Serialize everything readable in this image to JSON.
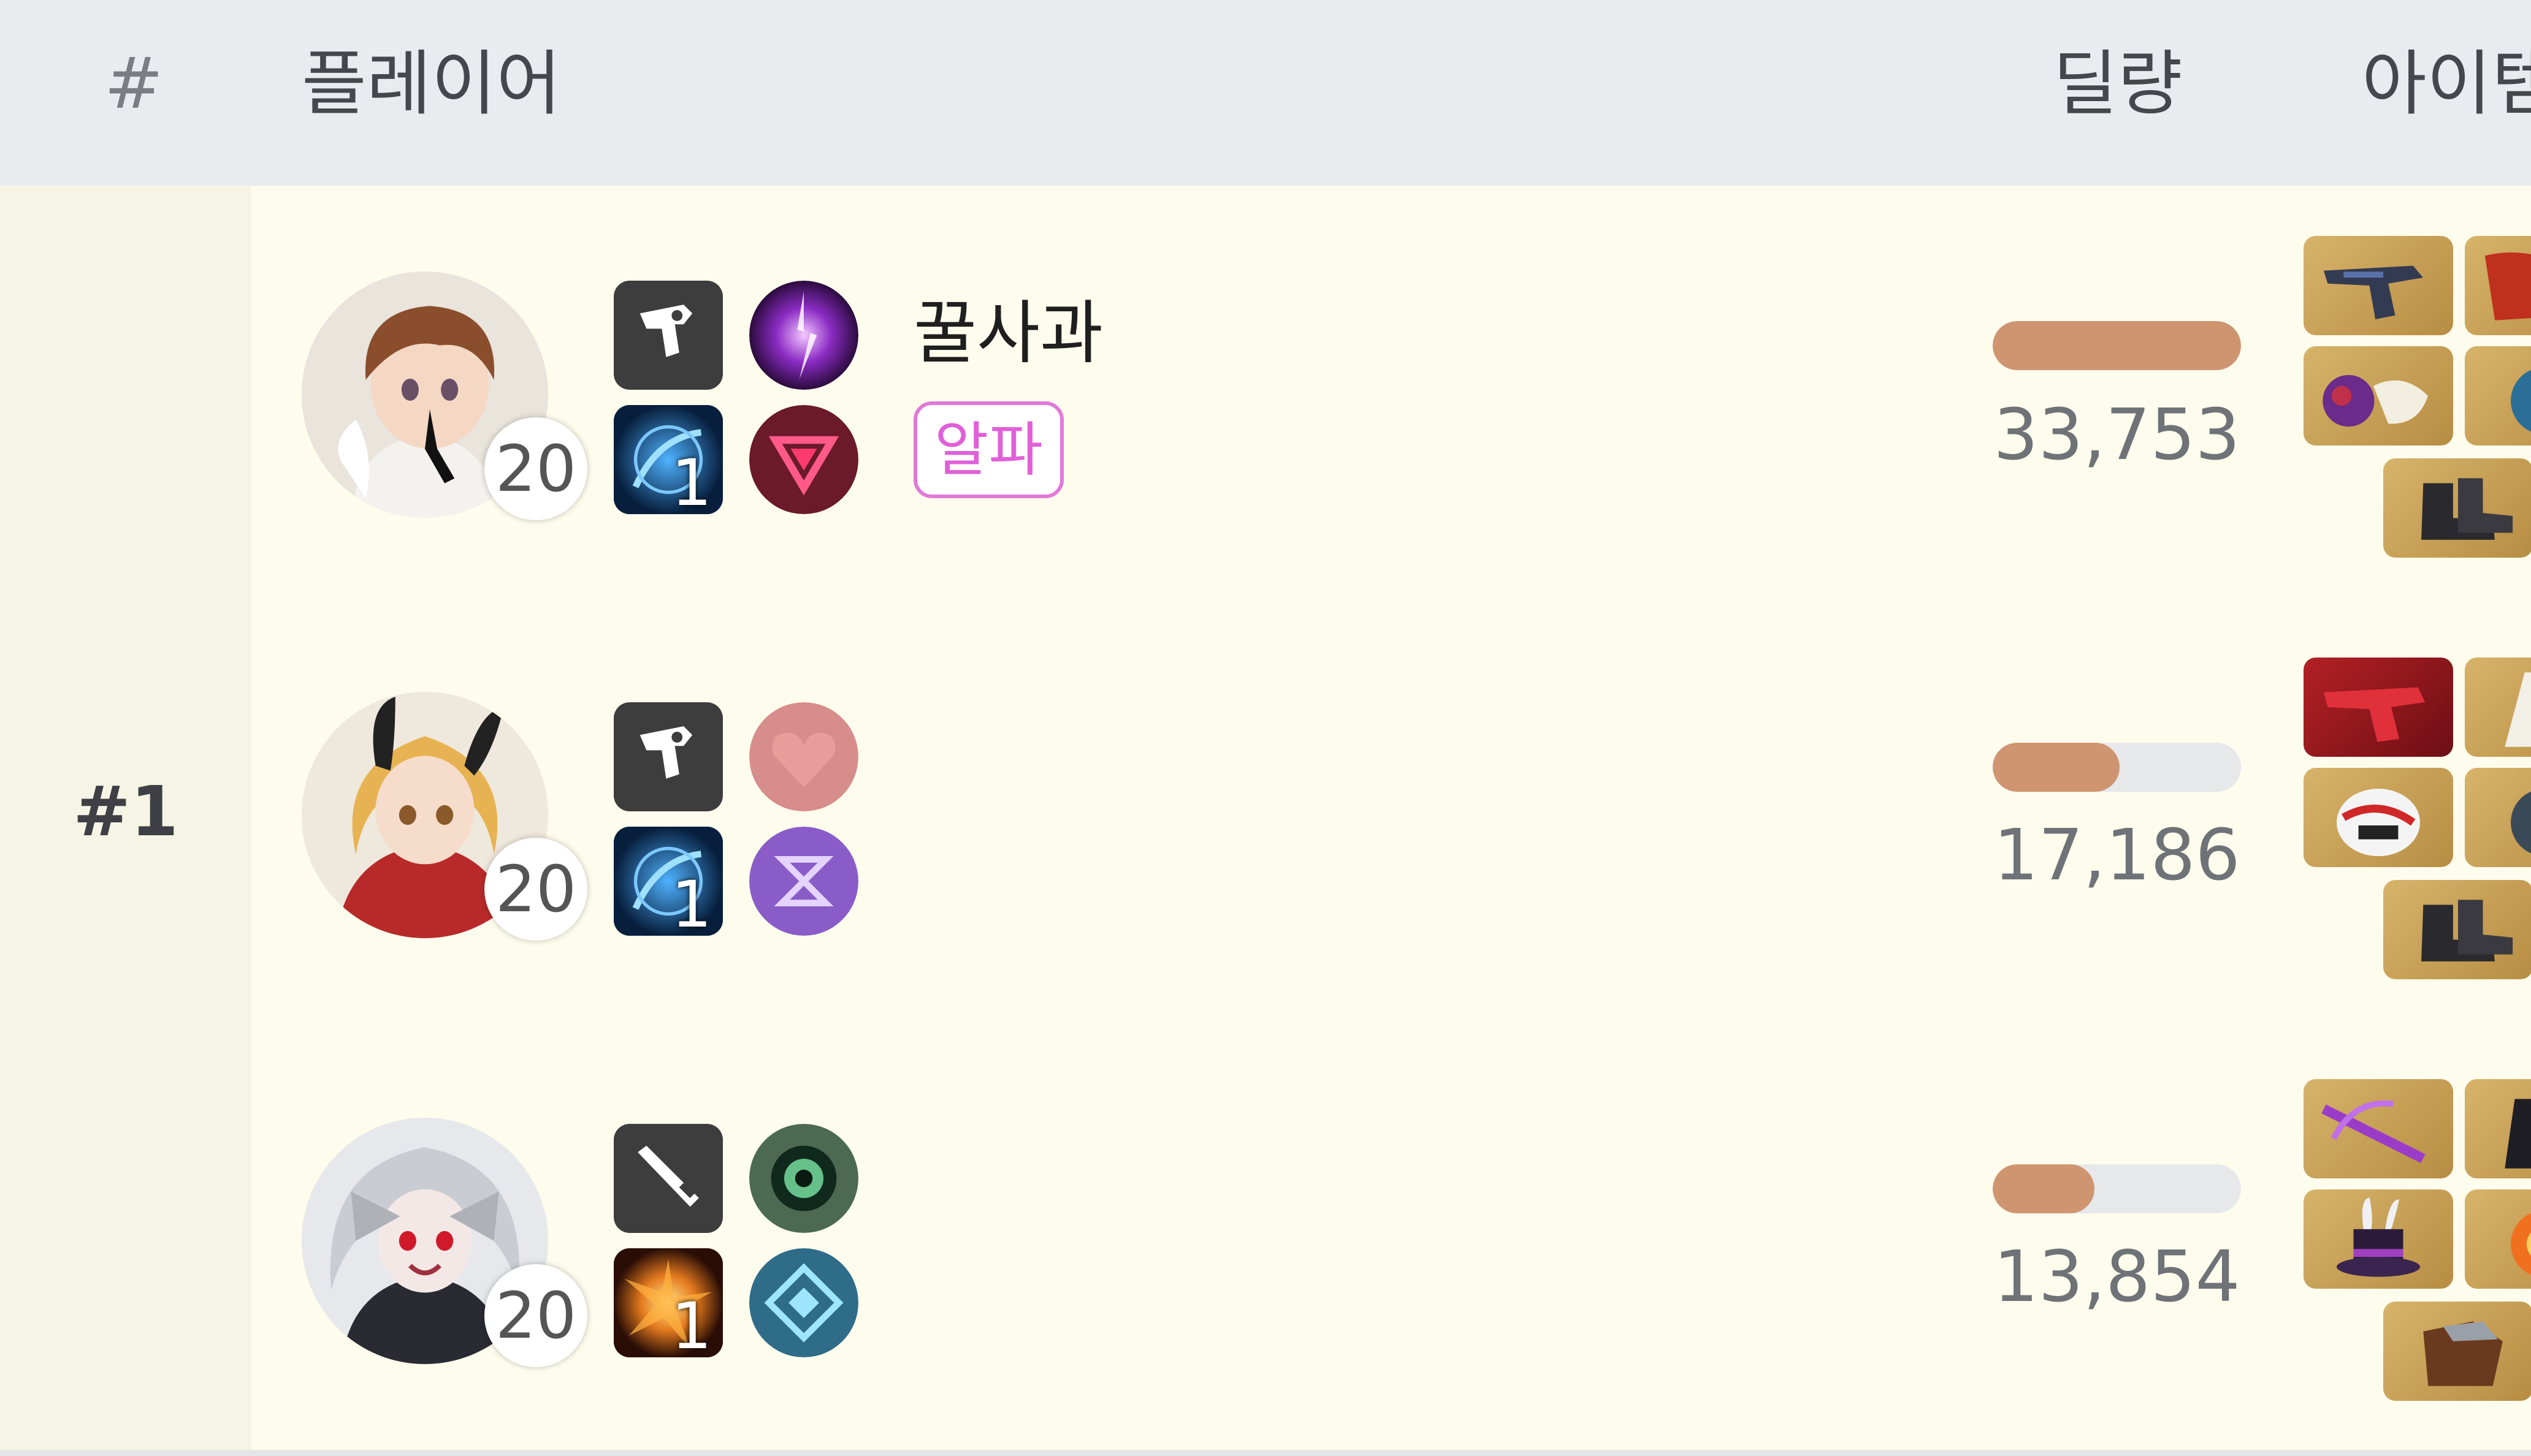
{
  "header": {
    "rank_col": "#",
    "player_col": "플레이어",
    "damage_col": "딜량",
    "items_col": "아이템"
  },
  "team": {
    "rank": "#1"
  },
  "players": [
    {
      "name": "꿀사과",
      "tier_badge": "알파",
      "level": "20",
      "skill_level": "1",
      "damage_text": "33,753",
      "damage_fraction": 1.0,
      "avatar_icon": "brown-hair-character-portrait",
      "weapon_icon": "revolver-icon",
      "trait_icon": "purple-lightning-trait-icon",
      "tactical_skill_icon": "blue-dash-skill-icon",
      "augment_icon": "red-triangle-augment-icon"
    },
    {
      "name": "",
      "tier_badge": "",
      "level": "20",
      "skill_level": "1",
      "damage_text": "17,186",
      "damage_fraction": 0.51,
      "avatar_icon": "blonde-hair-character-portrait",
      "weapon_icon": "revolver-icon",
      "trait_icon": "red-heart-trait-icon",
      "tactical_skill_icon": "blue-dash-skill-icon",
      "augment_icon": "purple-swirl-augment-icon"
    },
    {
      "name": "",
      "tier_badge": "",
      "level": "20",
      "skill_level": "1",
      "damage_text": "13,854",
      "damage_fraction": 0.41,
      "avatar_icon": "silver-hair-character-portrait",
      "weapon_icon": "bat-icon",
      "trait_icon": "green-eye-trait-icon",
      "tactical_skill_icon": "orange-burst-skill-icon",
      "augment_icon": "teal-diamond-augment-icon"
    }
  ],
  "colors": {
    "header_bg": "#e8ecef",
    "row_bg": "#fefcec",
    "damage_fill": "#cf9570",
    "tier_badge": "#e060d8"
  }
}
